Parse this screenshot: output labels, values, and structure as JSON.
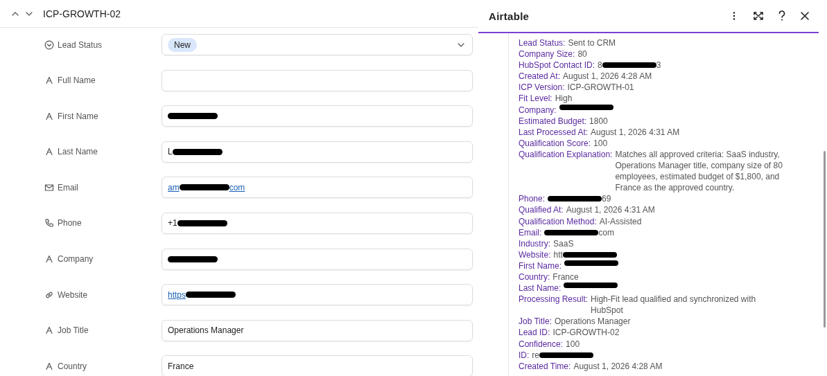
{
  "record": {
    "title": "ICP-GROWTH-02",
    "fields": [
      {
        "kind": "select",
        "label": "Lead Status",
        "chip": "New"
      },
      {
        "kind": "text",
        "label": "Full Name"
      },
      {
        "kind": "text",
        "label": "First Name",
        "redacted": true
      },
      {
        "kind": "text",
        "label": "Last Name",
        "value": "L",
        "redacted": true
      },
      {
        "kind": "email",
        "label": "Email",
        "value": "am",
        "redacted": true,
        "value_end": "com"
      },
      {
        "kind": "phone",
        "label": "Phone",
        "value": "+1",
        "redacted": true
      },
      {
        "kind": "text",
        "label": "Company",
        "redacted": true
      },
      {
        "kind": "link",
        "label": "Website",
        "value": "https",
        "redacted": true
      },
      {
        "kind": "text",
        "label": "Job Title",
        "value": "Operations Manager"
      },
      {
        "kind": "text",
        "label": "Country",
        "value": "France"
      }
    ]
  },
  "panel": {
    "title": "Airtable",
    "lines": [
      {
        "label": "Lead Status:",
        "value": "Sent to CRM"
      },
      {
        "label": "Company Size:",
        "value": "80"
      },
      {
        "label": "HubSpot Contact ID:",
        "value": "8",
        "redacted": true,
        "value_end": "3"
      },
      {
        "label": "Created At:",
        "value": "August 1, 2026 4:28 AM"
      },
      {
        "label": "ICP Version:",
        "value": "ICP-GROWTH-01"
      },
      {
        "label": "Fit Level:",
        "value": "High"
      },
      {
        "label": "Company:",
        "redacted": true
      },
      {
        "label": "Estimated Budget:",
        "value": "1800"
      },
      {
        "label": "Last Processed At:",
        "value": "August 1, 2026 4:31 AM"
      },
      {
        "label": "Qualification Score:",
        "value": "100"
      },
      {
        "label": "Qualification Explanation:",
        "value": "Matches all approved criteria: SaaS industry, Operations Manager title, company size of 80 employees, estimated budget of $1,800, and France as the approved country."
      },
      {
        "label": "Phone:",
        "redacted": true,
        "value_end": "69"
      },
      {
        "label": "Qualified At:",
        "value": "August 1, 2026 4:31 AM"
      },
      {
        "label": "Qualification Method:",
        "value": "AI-Assisted"
      },
      {
        "label": "Email:",
        "redacted": true,
        "value_end": "com"
      },
      {
        "label": "Industry:",
        "value": "SaaS"
      },
      {
        "label": "Website:",
        "value": "htt",
        "redacted": true
      },
      {
        "label": "First Name:",
        "redacted": true
      },
      {
        "label": "Country:",
        "value": "France"
      },
      {
        "label": "Last Name:",
        "redacted": true
      },
      {
        "label": "Processing Result:",
        "value": "High-Fit lead qualified and synchronized with HubSpot"
      },
      {
        "label": "Job Title:",
        "value": "Operations Manager"
      },
      {
        "label": "Lead ID:",
        "value": "ICP-GROWTH-02"
      },
      {
        "label": "Confidence:",
        "value": "100"
      },
      {
        "label": "ID:",
        "value": "re",
        "redacted": true
      },
      {
        "label": "Created Time:",
        "value": "August 1, 2026 4:28 AM"
      }
    ]
  }
}
